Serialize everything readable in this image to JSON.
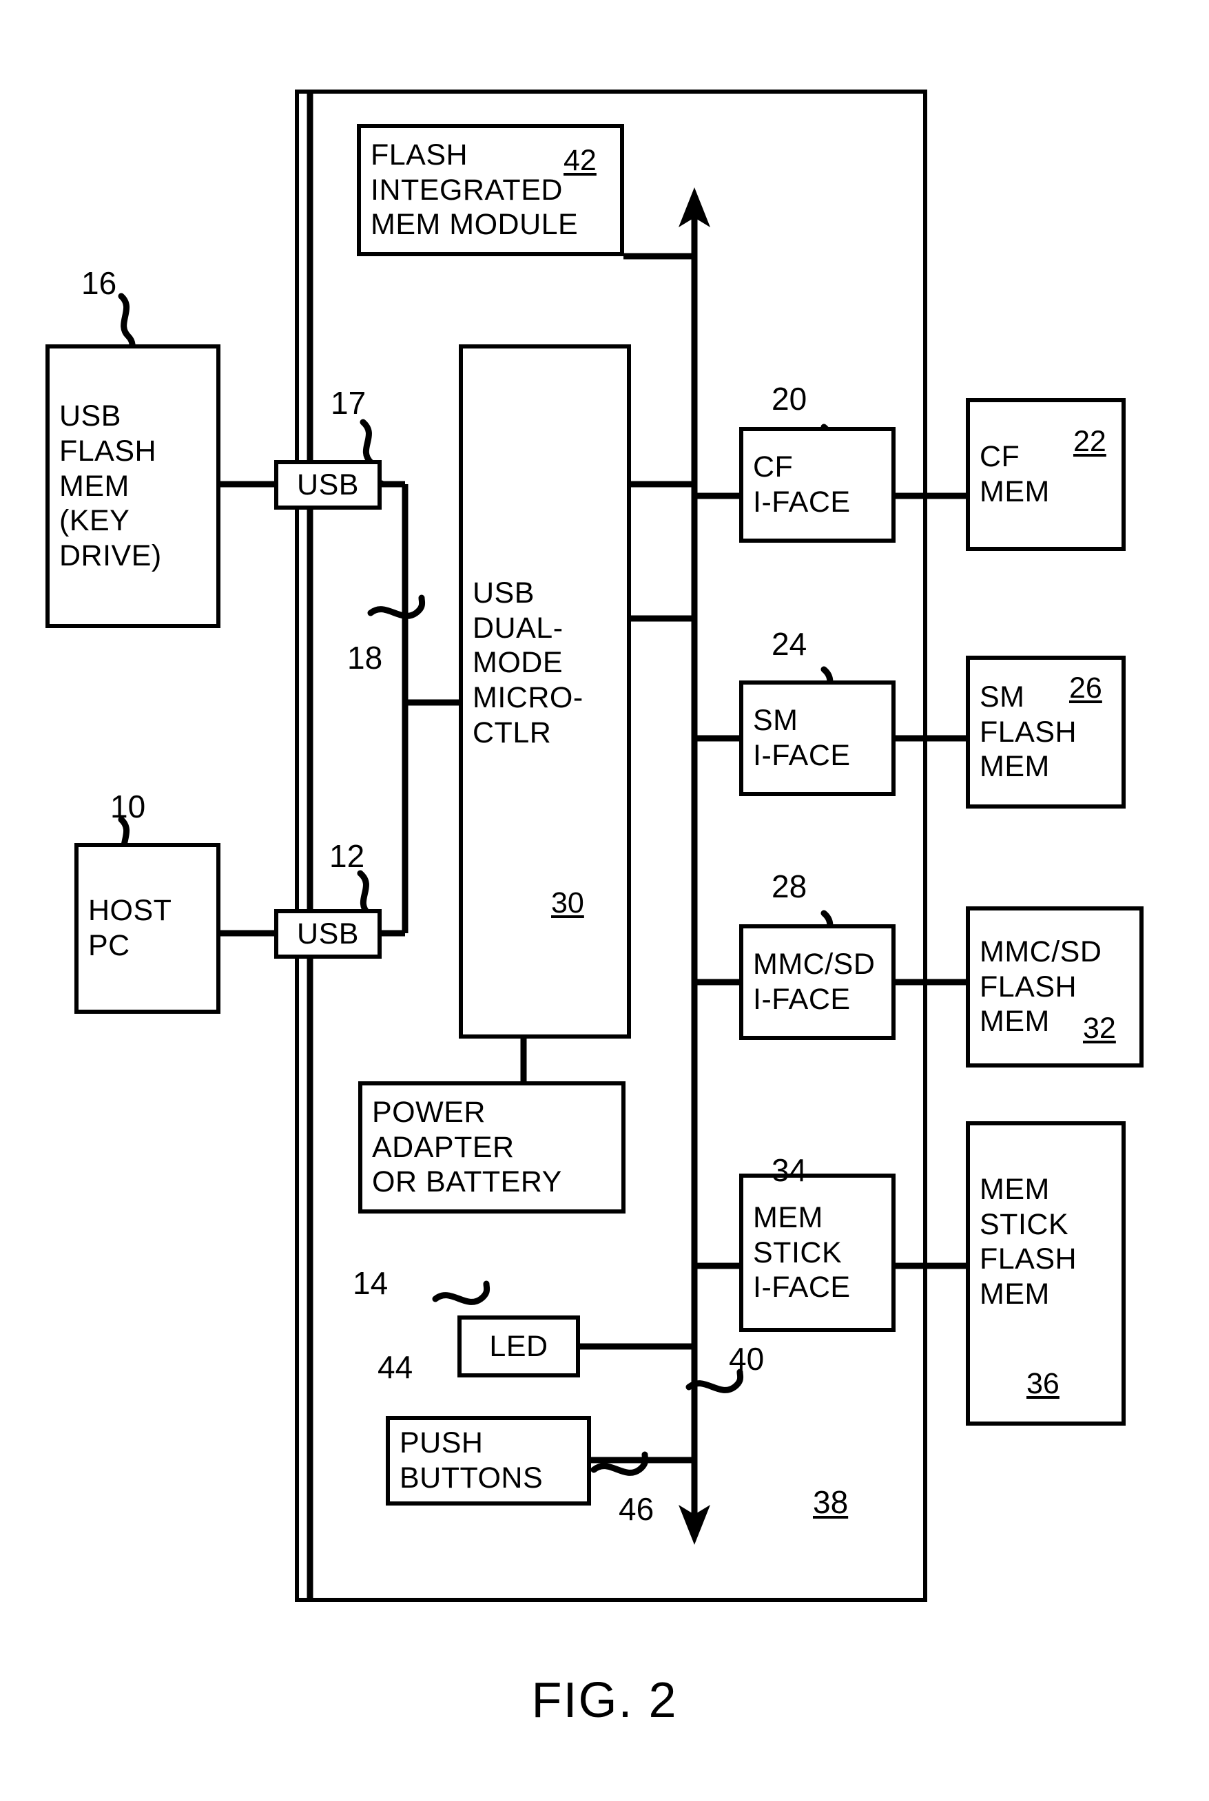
{
  "figure": {
    "caption": "FIG. 2",
    "enclosure_ref": "38"
  },
  "boxes": {
    "flash_integrated_mem_module": {
      "text": "FLASH\nINTEGRATED\nMEM MODULE",
      "ref": "42"
    },
    "usb_flash_mem_key_drive": {
      "text": "USB\nFLASH\nMEM\n(KEY\nDRIVE)",
      "ref": "16"
    },
    "usb_port_top": {
      "text": "USB",
      "ref": "17"
    },
    "usb_port_bottom": {
      "text": "USB",
      "ref": "12"
    },
    "host_pc": {
      "text": "HOST\nPC",
      "ref": "10"
    },
    "usb_dual_mode_micro_ctlr": {
      "text": "USB\nDUAL-\nMODE\nMICRO-\nCTLR",
      "ref": "30"
    },
    "power_adapter_or_battery": {
      "text": "POWER\nADAPTER\nOR BATTERY",
      "ref": "14"
    },
    "led": {
      "text": "LED",
      "ref": "44"
    },
    "push_buttons": {
      "text": "PUSH\nBUTTONS",
      "ref": "46"
    },
    "cf_iface": {
      "text": "CF\nI-FACE",
      "ref": "20"
    },
    "cf_mem": {
      "text": "CF\nMEM",
      "ref": "22"
    },
    "sm_iface": {
      "text": "SM\nI-FACE",
      "ref": "24"
    },
    "sm_flash_mem": {
      "text": "SM\nFLASH\nMEM",
      "ref": "26"
    },
    "mmc_sd_iface": {
      "text": "MMC/SD\nI-FACE",
      "ref": "28"
    },
    "mmc_sd_flash_mem": {
      "text": "MMC/SD\nFLASH\nMEM",
      "ref": "32"
    },
    "mem_stick_iface": {
      "text": "MEM\nSTICK\nI-FACE",
      "ref": "34"
    },
    "mem_stick_flash_mem": {
      "text": "MEM\nSTICK\nFLASH\nMEM",
      "ref": "36"
    }
  },
  "reference_numerals": {
    "n10": "10",
    "n12": "12",
    "n14": "14",
    "n16": "16",
    "n17": "17",
    "n18": "18",
    "n20": "20",
    "n22": "22",
    "n24": "24",
    "n26": "26",
    "n28": "28",
    "n30": "30",
    "n32": "32",
    "n34": "34",
    "n36": "36",
    "n38": "38",
    "n40": "40",
    "n42": "42",
    "n44": "44",
    "n46": "46"
  },
  "colors": {
    "line": "#000000",
    "background": "#ffffff"
  }
}
